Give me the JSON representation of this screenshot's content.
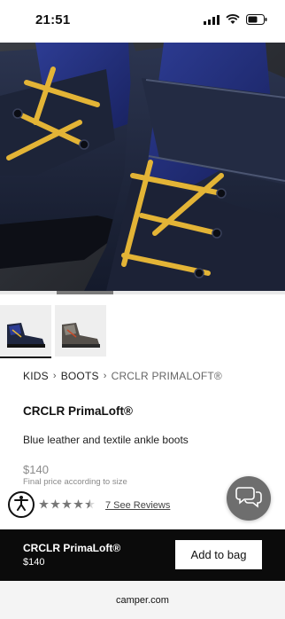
{
  "status_bar": {
    "time": "21:51"
  },
  "product_gallery": {
    "main_image": "blue-leather-ankle-boot-photo",
    "thumbnails": [
      "blue-boot-thumbnail",
      "grey-boot-thumbnail"
    ]
  },
  "breadcrumb": [
    "KIDS",
    "BOOTS",
    "CRCLR PRIMALOFT®"
  ],
  "product": {
    "title": "CRCLR PrimaLoft®",
    "description": "Blue leather and textile ankle boots",
    "price": "$140",
    "price_note": "Final price according to size"
  },
  "rating": {
    "value_out_of_5": 4.5,
    "reviews_label": "7 See Reviews"
  },
  "buy_bar": {
    "name": "CRCLR PrimaLoft®",
    "price": "$140",
    "cta": "Add to bag"
  },
  "browser": {
    "url": "camper.com"
  },
  "colors": {
    "boot_navy": "#1f2740",
    "lace_yellow": "#e3b436",
    "buy_bar": "#0b0b0b",
    "chat_button": "#6e6e6e"
  }
}
